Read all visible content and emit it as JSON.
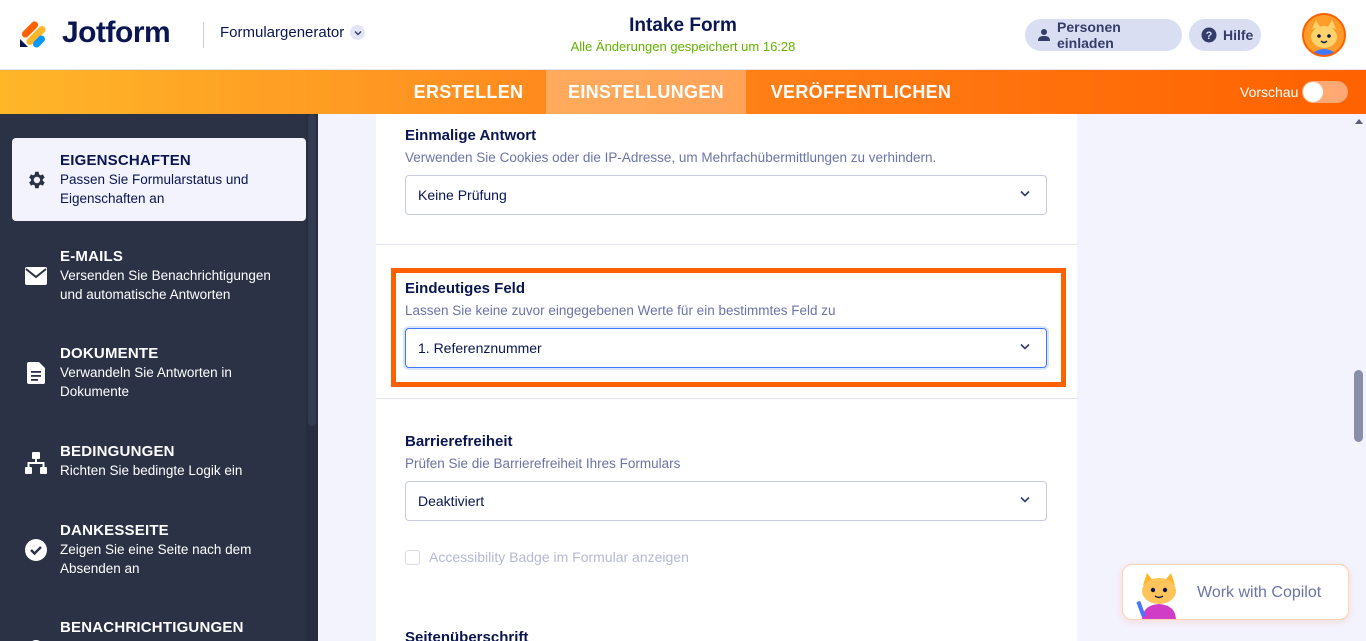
{
  "header": {
    "brand": "Jotform",
    "builder_label": "Formulargenerator",
    "form_title": "Intake Form",
    "save_status": "Alle Änderungen gespeichert um 16:28",
    "invite_label": "Personen einladen",
    "help_label": "Hilfe"
  },
  "nav": {
    "tabs": [
      {
        "label": "ERSTELLEN"
      },
      {
        "label": "EINSTELLUNGEN"
      },
      {
        "label": "VERÖFFENTLICHEN"
      }
    ],
    "active_tab": "EINSTELLUNGEN",
    "preview_label": "Vorschau",
    "preview_on": false
  },
  "sidebar": {
    "items": [
      {
        "title": "EIGENSCHAFTEN",
        "desc1": "Passen Sie Formularstatus und",
        "desc2": "Eigenschaften an",
        "icon": "gear-icon",
        "active": true
      },
      {
        "title": "E-MAILS",
        "desc1": "Versenden Sie Benachrichtigungen",
        "desc2": "und automatische Antworten",
        "icon": "envelope-icon"
      },
      {
        "title": "DOKUMENTE",
        "desc1": "Verwandeln Sie Antworten in",
        "desc2": "Dokumente",
        "icon": "document-icon"
      },
      {
        "title": "BEDINGUNGEN",
        "desc1": "Richten Sie bedingte Logik ein",
        "desc2": "",
        "icon": "sitemap-icon"
      },
      {
        "title": "DANKESSEITE",
        "desc1": "Zeigen Sie eine Seite nach dem",
        "desc2": "Absenden an",
        "icon": "check-circle-icon"
      },
      {
        "title": "BENACHRICHTIGUNGEN",
        "desc1": "",
        "desc2": "",
        "icon": "bell-icon"
      }
    ]
  },
  "settings": {
    "unique_submission": {
      "title": "Einmalige Antwort",
      "desc": "Verwenden Sie Cookies oder die IP-Adresse, um Mehrfachübermittlungen zu verhindern.",
      "value": "Keine Prüfung"
    },
    "unique_field": {
      "title": "Eindeutiges Feld",
      "desc": "Lassen Sie keine zuvor eingegebenen Werte für ein bestimmtes Feld zu",
      "value": "1. Referenznummer"
    },
    "accessibility": {
      "title": "Barrierefreiheit",
      "desc": "Prüfen Sie die Barrierefreiheit Ihres Formulars",
      "value": "Deaktiviert",
      "badge_label": "Accessibility Badge im Formular anzeigen",
      "badge_checked": false
    },
    "page_title": {
      "title": "Seitenüberschrift"
    }
  },
  "copilot": {
    "label": "Work with Copilot"
  },
  "colors": {
    "brand_orange": "#ff6100",
    "sidebar_bg": "#2b3245",
    "success_green": "#64b200",
    "navy": "#0a1551"
  }
}
